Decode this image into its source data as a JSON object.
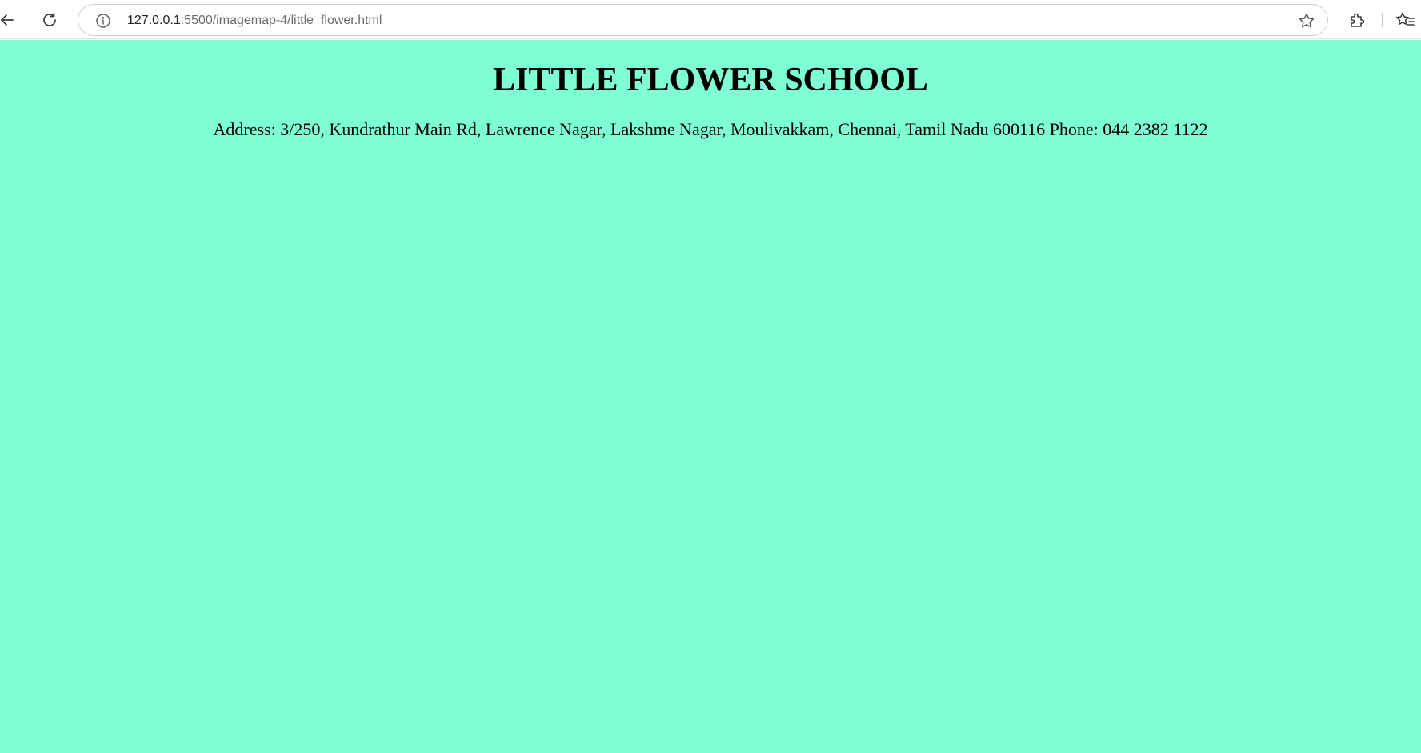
{
  "browser": {
    "url_host": "127.0.0.1",
    "url_path": ":5500/imagemap-4/little_flower.html",
    "icons": {
      "back": "arrow-left-icon",
      "reload": "reload-icon",
      "site_info": "info-icon",
      "bookmark": "star-icon",
      "extensions": "puzzle-icon",
      "favorites": "favorites-icon"
    }
  },
  "page": {
    "background_color": "#7fffd4",
    "title": "LITTLE FLOWER SCHOOL",
    "address_line": "Address: 3/250, Kundrathur Main Rd, Lawrence Nagar, Lakshme Nagar, Moulivakkam, Chennai, Tamil Nadu 600116 Phone: 044 2382 1122"
  }
}
